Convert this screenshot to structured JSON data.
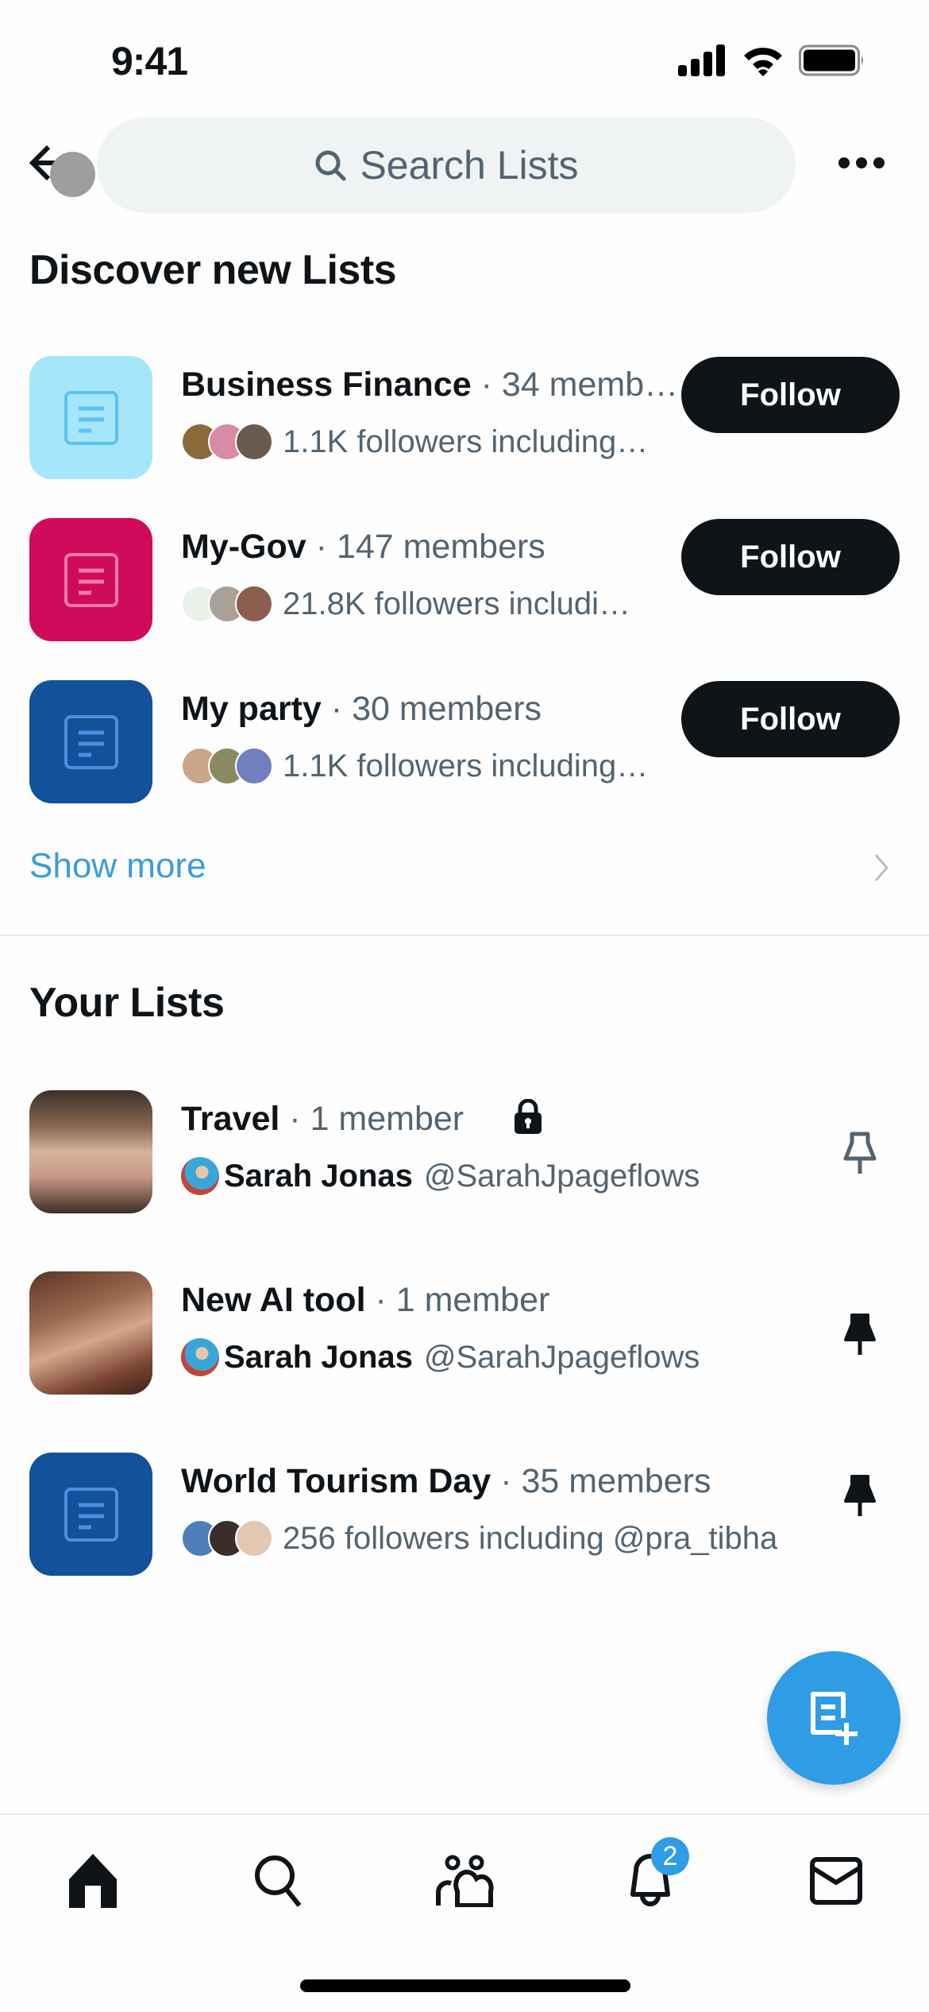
{
  "status_bar": {
    "time": "9:41"
  },
  "header": {
    "search_placeholder": "Search Lists"
  },
  "discover": {
    "title": "Discover new Lists",
    "items": [
      {
        "name": "Business Finance",
        "meta": "34 memb…",
        "followers": "1.1K followers including…",
        "tile_color": "#a6e6fb",
        "icon_color": "#5cc3ef",
        "action": "Follow",
        "avatar_colors": [
          "#8a6a3a",
          "#d98aa5",
          "#6b5a4e"
        ]
      },
      {
        "name": "My-Gov",
        "meta": "147 members",
        "followers": "21.8K followers includi…",
        "tile_color": "#d10b5c",
        "icon_color": "#f07aa8",
        "action": "Follow",
        "avatar_colors": [
          "#e9f2ea",
          "#a9a098",
          "#8b5e4e"
        ]
      },
      {
        "name": "My party",
        "meta": "30 members",
        "followers": "1.1K followers including…",
        "tile_color": "#13519b",
        "icon_color": "#4a8fe0",
        "action": "Follow",
        "avatar_colors": [
          "#c9a58a",
          "#8a8a62",
          "#6f7fbf"
        ]
      }
    ],
    "show_more": "Show more"
  },
  "your_lists": {
    "title": "Your Lists",
    "items": [
      {
        "name": "Travel",
        "meta": "1 member",
        "private": true,
        "owner_name": "Sarah Jonas",
        "owner_handle": "@SarahJpageflows",
        "pinned": false
      },
      {
        "name": "New AI tool",
        "meta": "1 member",
        "private": false,
        "owner_name": "Sarah Jonas",
        "owner_handle": "@SarahJpageflows",
        "pinned": true
      },
      {
        "name": "World Tourism Day",
        "meta": "35 members",
        "followers": "256 followers including @pra_tibha",
        "tile_color": "#13519b",
        "pinned": true,
        "avatar_colors": [
          "#4c7fb8",
          "#3a2d2a",
          "#e3c7b3"
        ]
      }
    ]
  },
  "tabbar": {
    "items": [
      "home",
      "search",
      "communities",
      "notifications",
      "messages"
    ],
    "notification_count": "2"
  },
  "colors": {
    "accent": "#2f9ce6",
    "link": "#3b9cd6",
    "text_secondary": "#536471"
  }
}
